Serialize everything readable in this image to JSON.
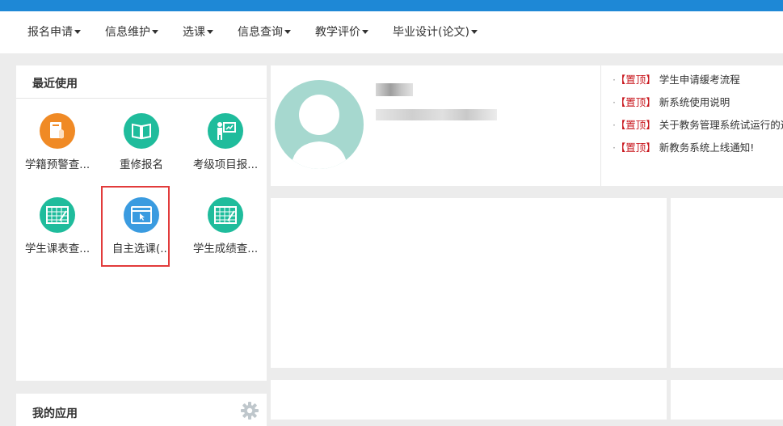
{
  "nav": {
    "items": [
      {
        "label": "报名申请"
      },
      {
        "label": "信息维护"
      },
      {
        "label": "选课"
      },
      {
        "label": "信息查询"
      },
      {
        "label": "教学评价"
      },
      {
        "label": "毕业设计(论文)"
      }
    ]
  },
  "recent": {
    "title": "最近使用",
    "apps": [
      {
        "label": "学籍预警查...",
        "icon": "student-record-icon",
        "color": "#f08a25"
      },
      {
        "label": "重修报名",
        "icon": "book-icon",
        "color": "#1fbc9c"
      },
      {
        "label": "考级项目报...",
        "icon": "presentation-icon",
        "color": "#1fbc9c"
      },
      {
        "label": "学生课表查...",
        "icon": "timetable-icon",
        "color": "#1fbc9c"
      },
      {
        "label": "自主选课(...",
        "icon": "window-cursor-icon",
        "color": "#3a9be0"
      },
      {
        "label": "学生成绩查...",
        "icon": "grades-table-icon",
        "color": "#1fbc9c"
      }
    ]
  },
  "myapps": {
    "title": "我的应用"
  },
  "notices": [
    {
      "tag": "【置顶】",
      "text": "学生申请缓考流程"
    },
    {
      "tag": "【置顶】",
      "text": "新系统使用说明"
    },
    {
      "tag": "【置顶】",
      "text": "关于教务管理系统试运行的通"
    },
    {
      "tag": "【置顶】",
      "text": "新教务系统上线通知!"
    }
  ],
  "notice_bullet": "·",
  "colors": {
    "topbar": "#1e88d6",
    "accent_red": "#c8161d",
    "highlight": "#e23b3b"
  }
}
